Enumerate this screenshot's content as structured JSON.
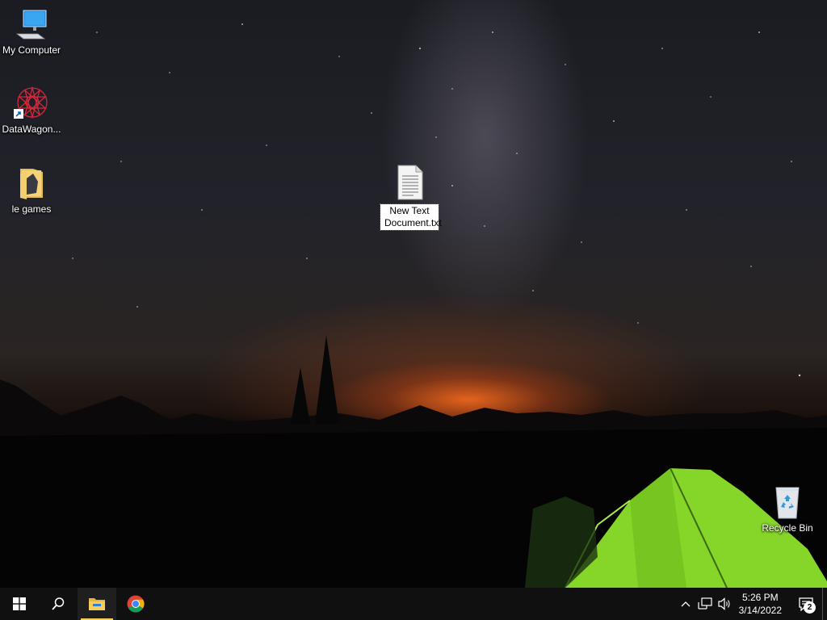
{
  "desktop": {
    "icons": {
      "my_computer": "My Computer",
      "datawagon": "DataWagon...",
      "le_games": "le games",
      "new_text": "New Text Document.txt",
      "recycle_bin": "Recycle Bin"
    }
  },
  "taskbar": {
    "start_icon": "windows-logo-icon",
    "search_icon": "search-icon",
    "pinned": [
      "file-explorer",
      "google-chrome"
    ],
    "clock_time": "5:26 PM",
    "clock_date": "3/14/2022",
    "notification_count": "2"
  },
  "colors": {
    "taskbar": "#101010",
    "active_indicator": "#f4cf55",
    "tent": "#86d62a"
  }
}
